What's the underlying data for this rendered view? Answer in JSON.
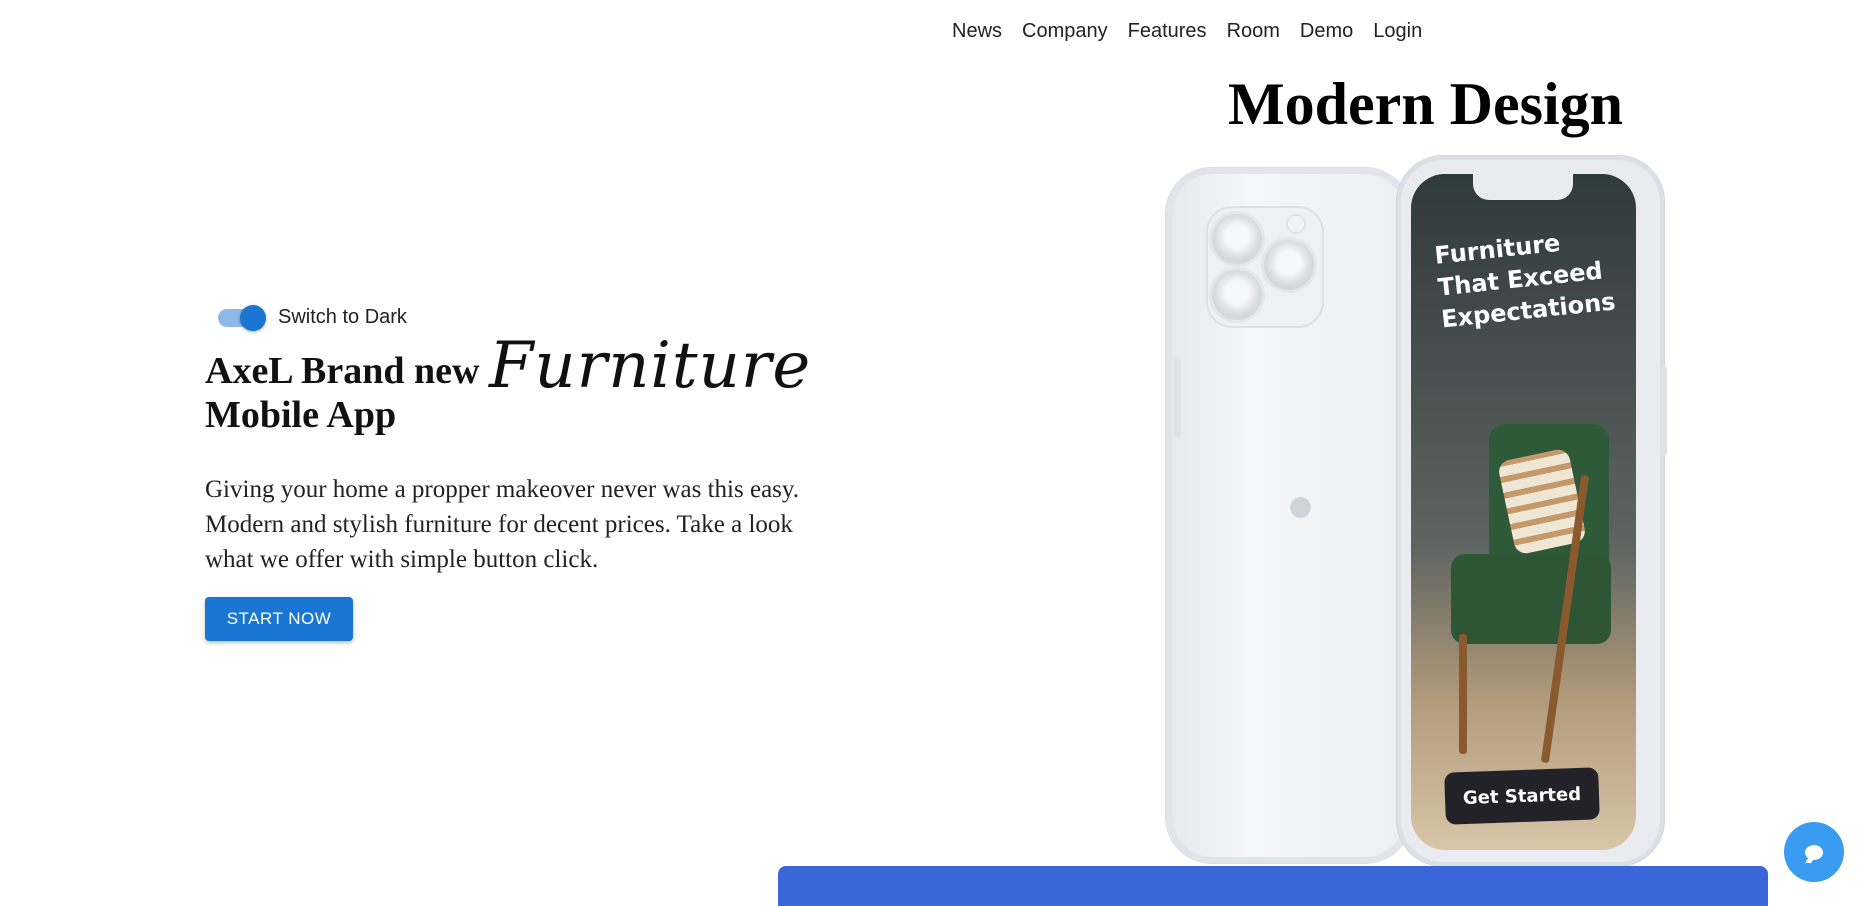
{
  "nav": {
    "items": [
      "News",
      "Company",
      "Features",
      "Room",
      "Demo",
      "Login"
    ]
  },
  "hero": {
    "right_title": "Modern Design",
    "toggle_label": "Switch to Dark",
    "toggle_on": true,
    "title_prefix": "AxeL Brand new",
    "title_script": "Furniture",
    "title_suffix": "Mobile App",
    "description": "Giving your home a propper makeover never was this easy. Modern and stylish furniture for decent prices. Take a look what we offer with simple button click.",
    "cta_label": "START NOW"
  },
  "phone": {
    "screen_headline": "Furniture That Exceed Expectations",
    "screen_button": "Get Started"
  },
  "colors": {
    "primary": "#1976d2",
    "bottom_bar": "#3b66d8",
    "chat_button": "#3a9cf0"
  },
  "icons": {
    "chat": "chat-bubble-icon",
    "apple": "apple-logo-icon"
  }
}
